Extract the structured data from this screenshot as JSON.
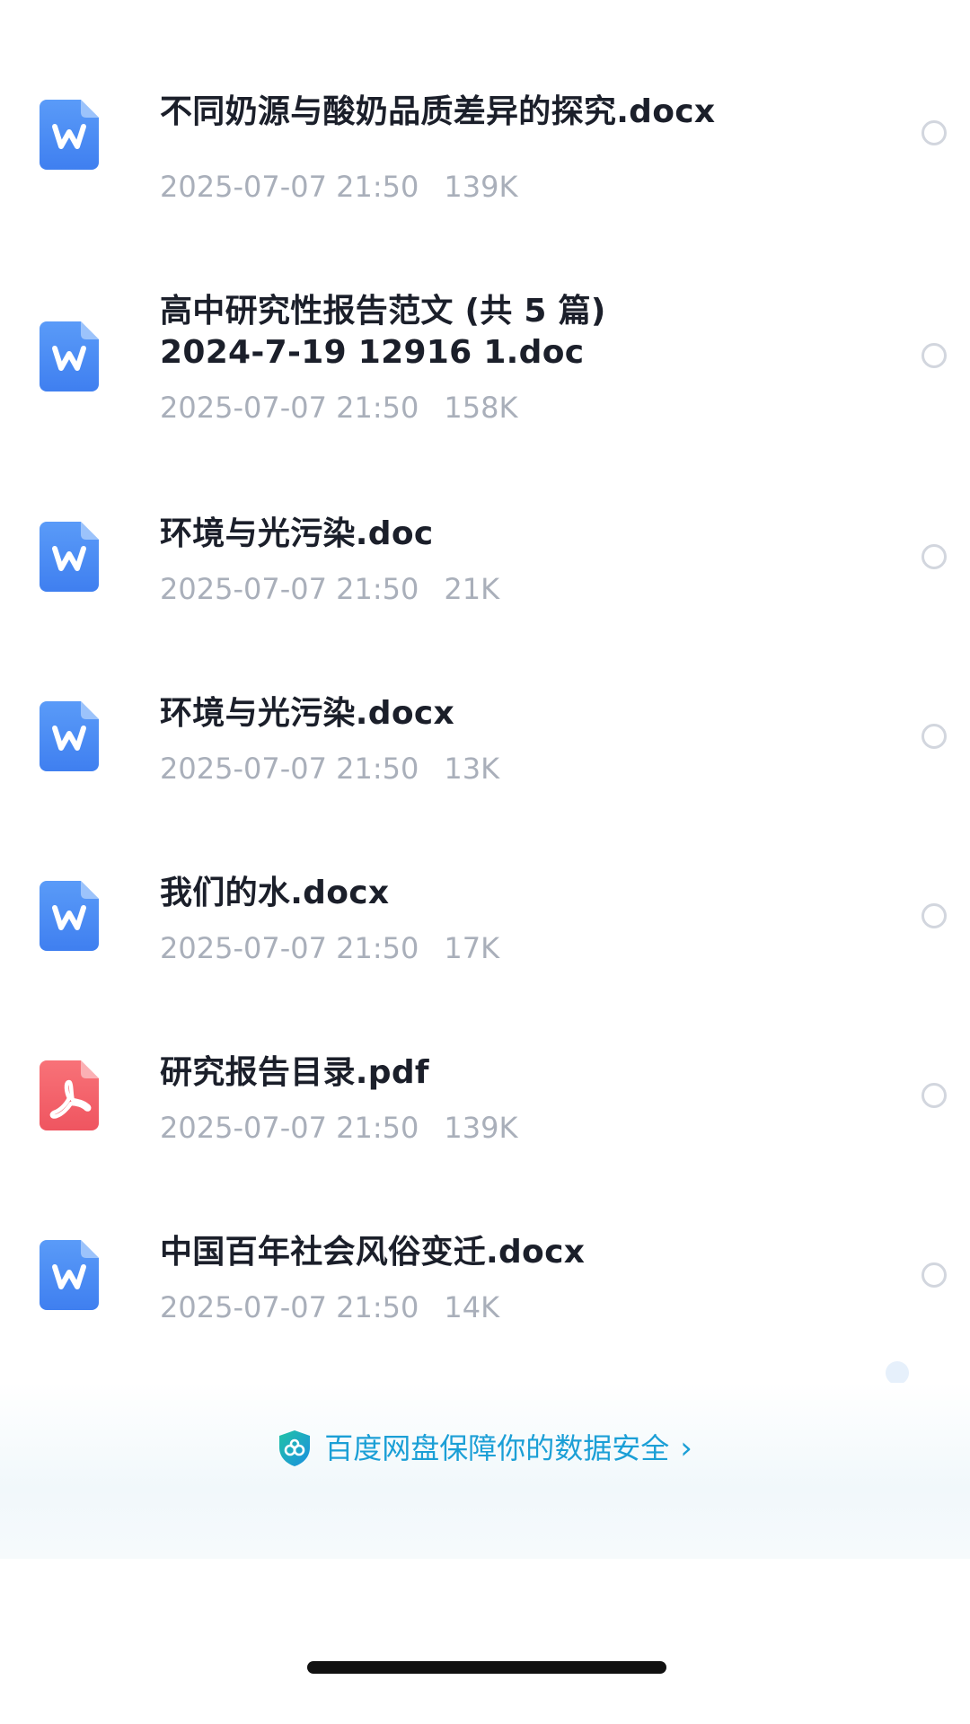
{
  "files": [
    {
      "name": "不同奶源与酸奶品质差异的探究.docx",
      "date": "2025-07-07 21:50",
      "size": "139K",
      "type": "word"
    },
    {
      "name": "高中研究性报告范文 (共 5 篇)\n2024-7-19 12916 1.doc",
      "date": "2025-07-07 21:50",
      "size": "158K",
      "type": "word"
    },
    {
      "name": "环境与光污染.doc",
      "date": "2025-07-07 21:50",
      "size": "21K",
      "type": "word"
    },
    {
      "name": "环境与光污染.docx",
      "date": "2025-07-07 21:50",
      "size": "13K",
      "type": "word"
    },
    {
      "name": "我们的水.docx",
      "date": "2025-07-07 21:50",
      "size": "17K",
      "type": "word"
    },
    {
      "name": "研究报告目录.pdf",
      "date": "2025-07-07 21:50",
      "size": "139K",
      "type": "pdf"
    },
    {
      "name": "中国百年社会风俗变迁.docx",
      "date": "2025-07-07 21:50",
      "size": "14K",
      "type": "word"
    }
  ],
  "footer": {
    "security_text": "百度网盘保障你的数据安全",
    "security_icon": "shield-icon",
    "chevron_icon": "chevron-right-icon"
  },
  "colors": {
    "word_icon": "#4c8ef7",
    "pdf_icon": "#f3656b",
    "link": "#1b9fd6",
    "meta_text": "#a9afba",
    "title_text": "#1b1f2a"
  }
}
